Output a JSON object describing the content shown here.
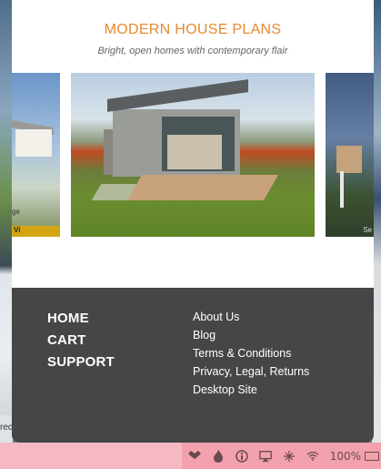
{
  "modal": {
    "title": "MODERN HOUSE PLANS",
    "subtitle": "Bright, open homes with contemporary flair"
  },
  "carousel": {
    "left_caption": "ge",
    "left_tag": "Vi",
    "right_caption": "Se"
  },
  "footer": {
    "main_links": [
      "HOME",
      "CART",
      "SUPPORT"
    ],
    "sub_links": [
      "About Us",
      "Blog",
      "Terms & Conditions",
      "Privacy, Legal, Returns",
      "Desktop Site"
    ]
  },
  "background": {
    "left_fragment": "red"
  },
  "menubar": {
    "battery": "100%",
    "icons": [
      "dropbox-icon",
      "flame-icon",
      "info-icon",
      "airplay-icon",
      "network-icon",
      "wifi-icon",
      "battery-icon"
    ],
    "colors": {
      "bar": "#f2a1ad",
      "accent_title": "#e68a2e",
      "footer_bg": "#464646"
    }
  }
}
